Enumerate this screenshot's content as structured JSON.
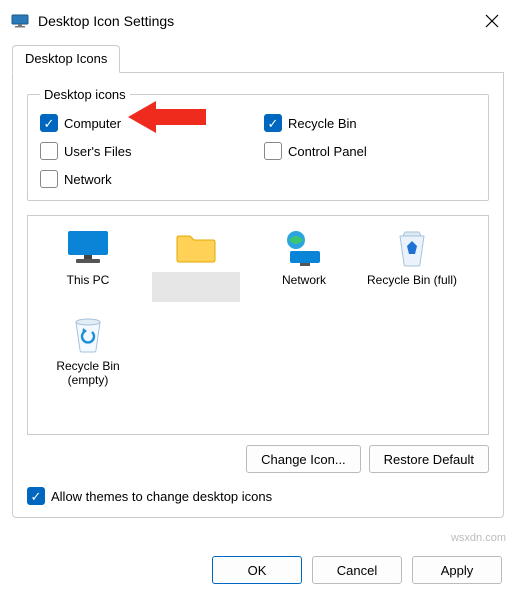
{
  "window": {
    "title": "Desktop Icon Settings"
  },
  "tabs": {
    "active": "Desktop Icons"
  },
  "group": {
    "legend": "Desktop icons"
  },
  "checks": {
    "computer": {
      "label": "Computer",
      "checked": true
    },
    "recycle_bin": {
      "label": "Recycle Bin",
      "checked": true
    },
    "users_files": {
      "label": "User's Files",
      "checked": false
    },
    "control_panel": {
      "label": "Control Panel",
      "checked": false
    },
    "network": {
      "label": "Network",
      "checked": false
    }
  },
  "icons": {
    "this_pc": {
      "label": "This PC"
    },
    "folder": {
      "label": ""
    },
    "network": {
      "label": "Network"
    },
    "recycle_full": {
      "label": "Recycle Bin (full)"
    },
    "recycle_empty": {
      "label": "Recycle Bin (empty)"
    }
  },
  "buttons": {
    "change_icon": "Change Icon...",
    "restore_default": "Restore Default",
    "ok": "OK",
    "cancel": "Cancel",
    "apply": "Apply"
  },
  "allow_themes": {
    "label": "Allow themes to change desktop icons",
    "checked": true
  },
  "watermark": "wsxdn.com"
}
